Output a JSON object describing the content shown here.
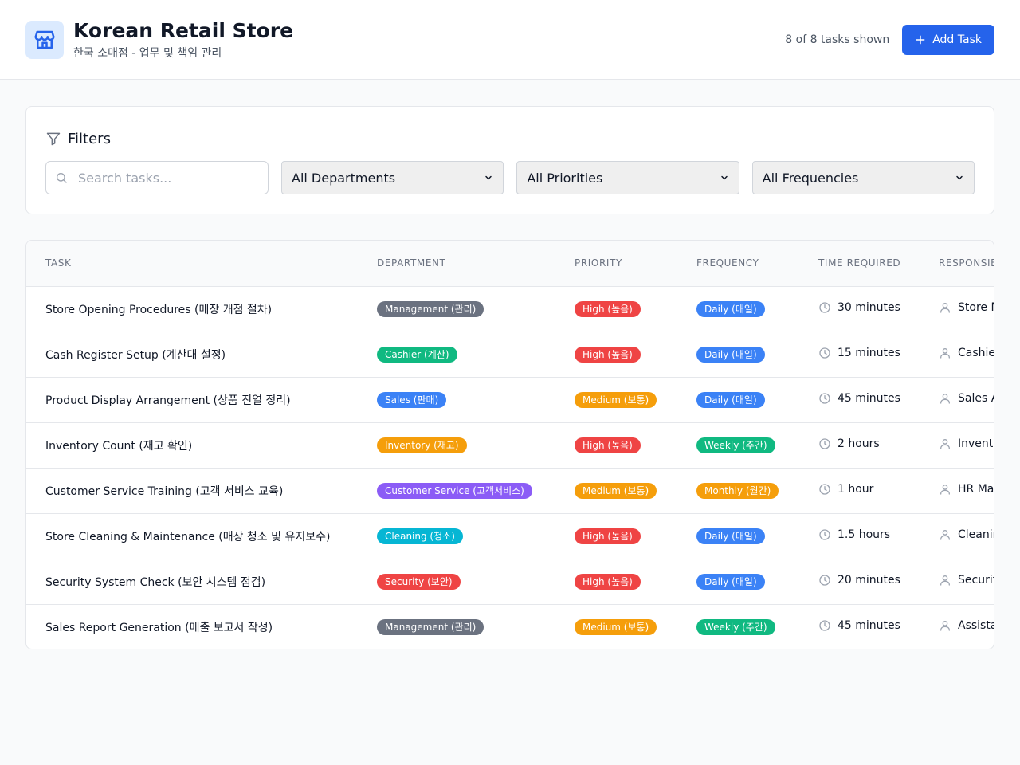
{
  "header": {
    "title": "Korean Retail Store",
    "subtitle": "한국 소매점 - 업무 및 책임 관리",
    "task_count": "8 of 8 tasks shown",
    "add_label": "Add Task",
    "icon": "store-icon"
  },
  "filters": {
    "title": "Filters",
    "search_placeholder": "Search tasks...",
    "department": "All Departments",
    "priority": "All Priorities",
    "frequency": "All Frequencies"
  },
  "table": {
    "headers": [
      "Task",
      "Department",
      "Priority",
      "Frequency",
      "Time Required",
      "Responsible"
    ],
    "rows": [
      {
        "task": "Store Opening Procedures (매장 개점 절차)",
        "department": "Management (관리)",
        "dept_color": "#6b7280",
        "priority": "High (높음)",
        "priority_color": "#ef4444",
        "frequency": "Daily (매일)",
        "freq_color": "#3b82f6",
        "time": "30 minutes",
        "responsible": "Store M"
      },
      {
        "task": "Cash Register Setup (계산대 설정)",
        "department": "Cashier (계산)",
        "dept_color": "#10b981",
        "priority": "High (높음)",
        "priority_color": "#ef4444",
        "frequency": "Daily (매일)",
        "freq_color": "#3b82f6",
        "time": "15 minutes",
        "responsible": "Cashie"
      },
      {
        "task": "Product Display Arrangement (상품 진열 정리)",
        "department": "Sales (판매)",
        "dept_color": "#3b82f6",
        "priority": "Medium (보통)",
        "priority_color": "#f59e0b",
        "frequency": "Daily (매일)",
        "freq_color": "#3b82f6",
        "time": "45 minutes",
        "responsible": "Sales A"
      },
      {
        "task": "Inventory Count (재고 확인)",
        "department": "Inventory (재고)",
        "dept_color": "#f59e0b",
        "priority": "High (높음)",
        "priority_color": "#ef4444",
        "frequency": "Weekly (주간)",
        "freq_color": "#10b981",
        "time": "2 hours",
        "responsible": "Invento"
      },
      {
        "task": "Customer Service Training (고객 서비스 교육)",
        "department": "Customer Service (고객서비스)",
        "dept_color": "#8b5cf6",
        "priority": "Medium (보통)",
        "priority_color": "#f59e0b",
        "frequency": "Monthly (월간)",
        "freq_color": "#f59e0b",
        "time": "1 hour",
        "responsible": "HR Ma"
      },
      {
        "task": "Store Cleaning & Maintenance (매장 청소 및 유지보수)",
        "department": "Cleaning (청소)",
        "dept_color": "#06b6d4",
        "priority": "High (높음)",
        "priority_color": "#ef4444",
        "frequency": "Daily (매일)",
        "freq_color": "#3b82f6",
        "time": "1.5 hours",
        "responsible": "Cleanin"
      },
      {
        "task": "Security System Check (보안 시스템 점검)",
        "department": "Security (보안)",
        "dept_color": "#ef4444",
        "priority": "High (높음)",
        "priority_color": "#ef4444",
        "frequency": "Daily (매일)",
        "freq_color": "#3b82f6",
        "time": "20 minutes",
        "responsible": "Securit"
      },
      {
        "task": "Sales Report Generation (매출 보고서 작성)",
        "department": "Management (관리)",
        "dept_color": "#6b7280",
        "priority": "Medium (보통)",
        "priority_color": "#f59e0b",
        "frequency": "Weekly (주간)",
        "freq_color": "#10b981",
        "time": "45 minutes",
        "responsible": "Assista"
      }
    ]
  }
}
